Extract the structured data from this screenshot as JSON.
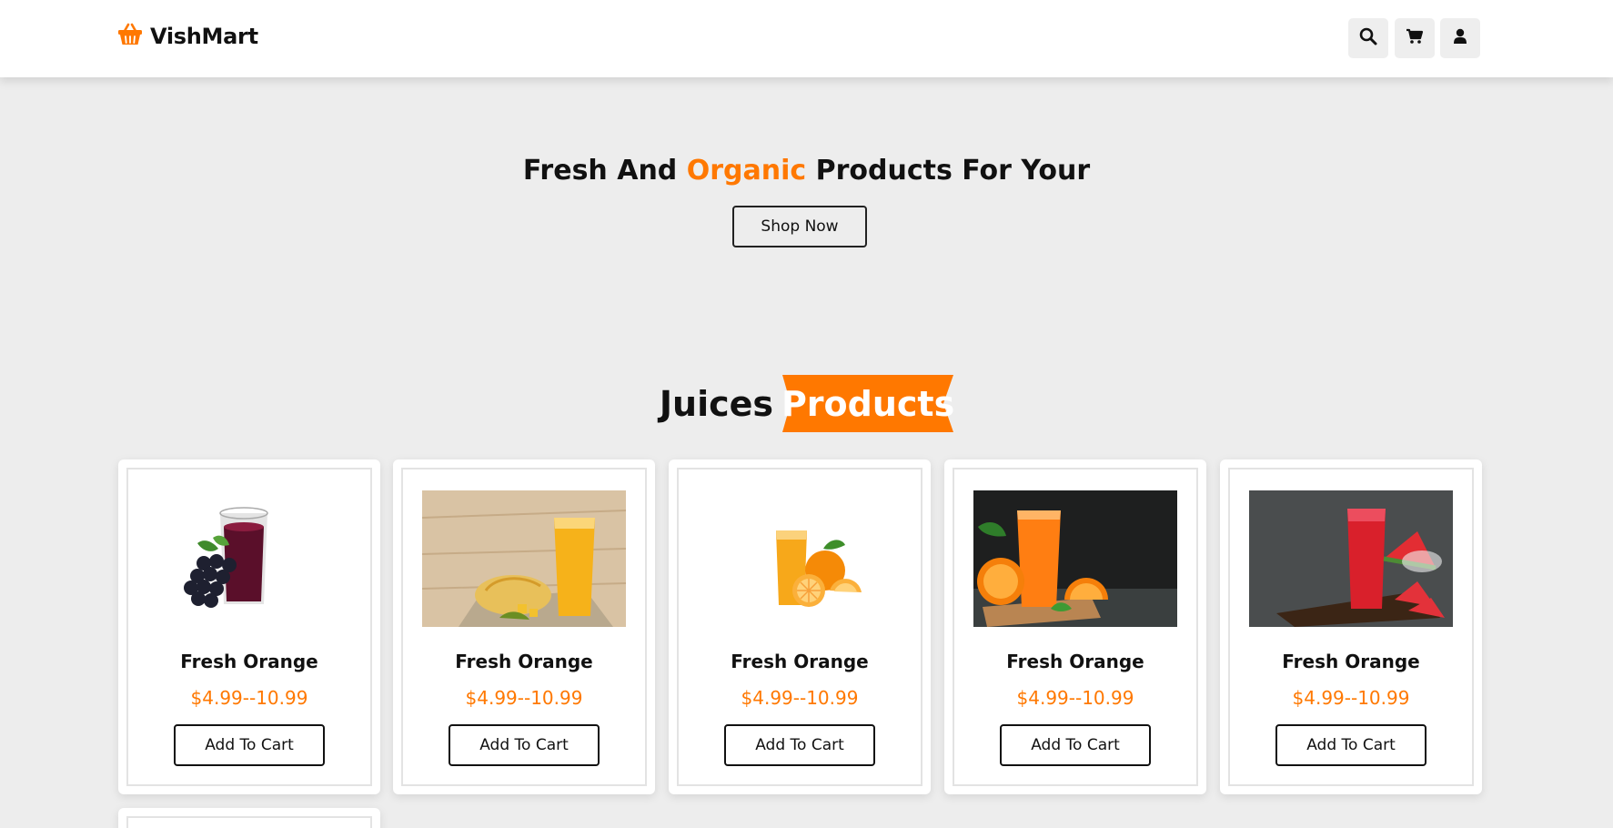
{
  "header": {
    "brand": "VishMart",
    "icons": [
      "basket-icon",
      "search-icon",
      "cart-icon",
      "user-icon"
    ]
  },
  "hero": {
    "title_part1": "Fresh And ",
    "title_accent": "Organic",
    "title_part2": " Products For Your",
    "button_label": "Shop Now"
  },
  "section": {
    "title_plain": "Juices",
    "title_badge": "Products"
  },
  "products": [
    {
      "name": "Fresh Orange",
      "price": "$4.99--10.99",
      "button": "Add To Cart",
      "image": "grape-juice"
    },
    {
      "name": "Fresh Orange",
      "price": "$4.99--10.99",
      "button": "Add To Cart",
      "image": "mango-juice"
    },
    {
      "name": "Fresh Orange",
      "price": "$4.99--10.99",
      "button": "Add To Cart",
      "image": "orange-juice-white"
    },
    {
      "name": "Fresh Orange",
      "price": "$4.99--10.99",
      "button": "Add To Cart",
      "image": "orange-juice-dark"
    },
    {
      "name": "Fresh Orange",
      "price": "$4.99--10.99",
      "button": "Add To Cart",
      "image": "watermelon-juice"
    }
  ],
  "colors": {
    "accent": "#ff7800",
    "background": "#ededed",
    "text": "#111111"
  }
}
